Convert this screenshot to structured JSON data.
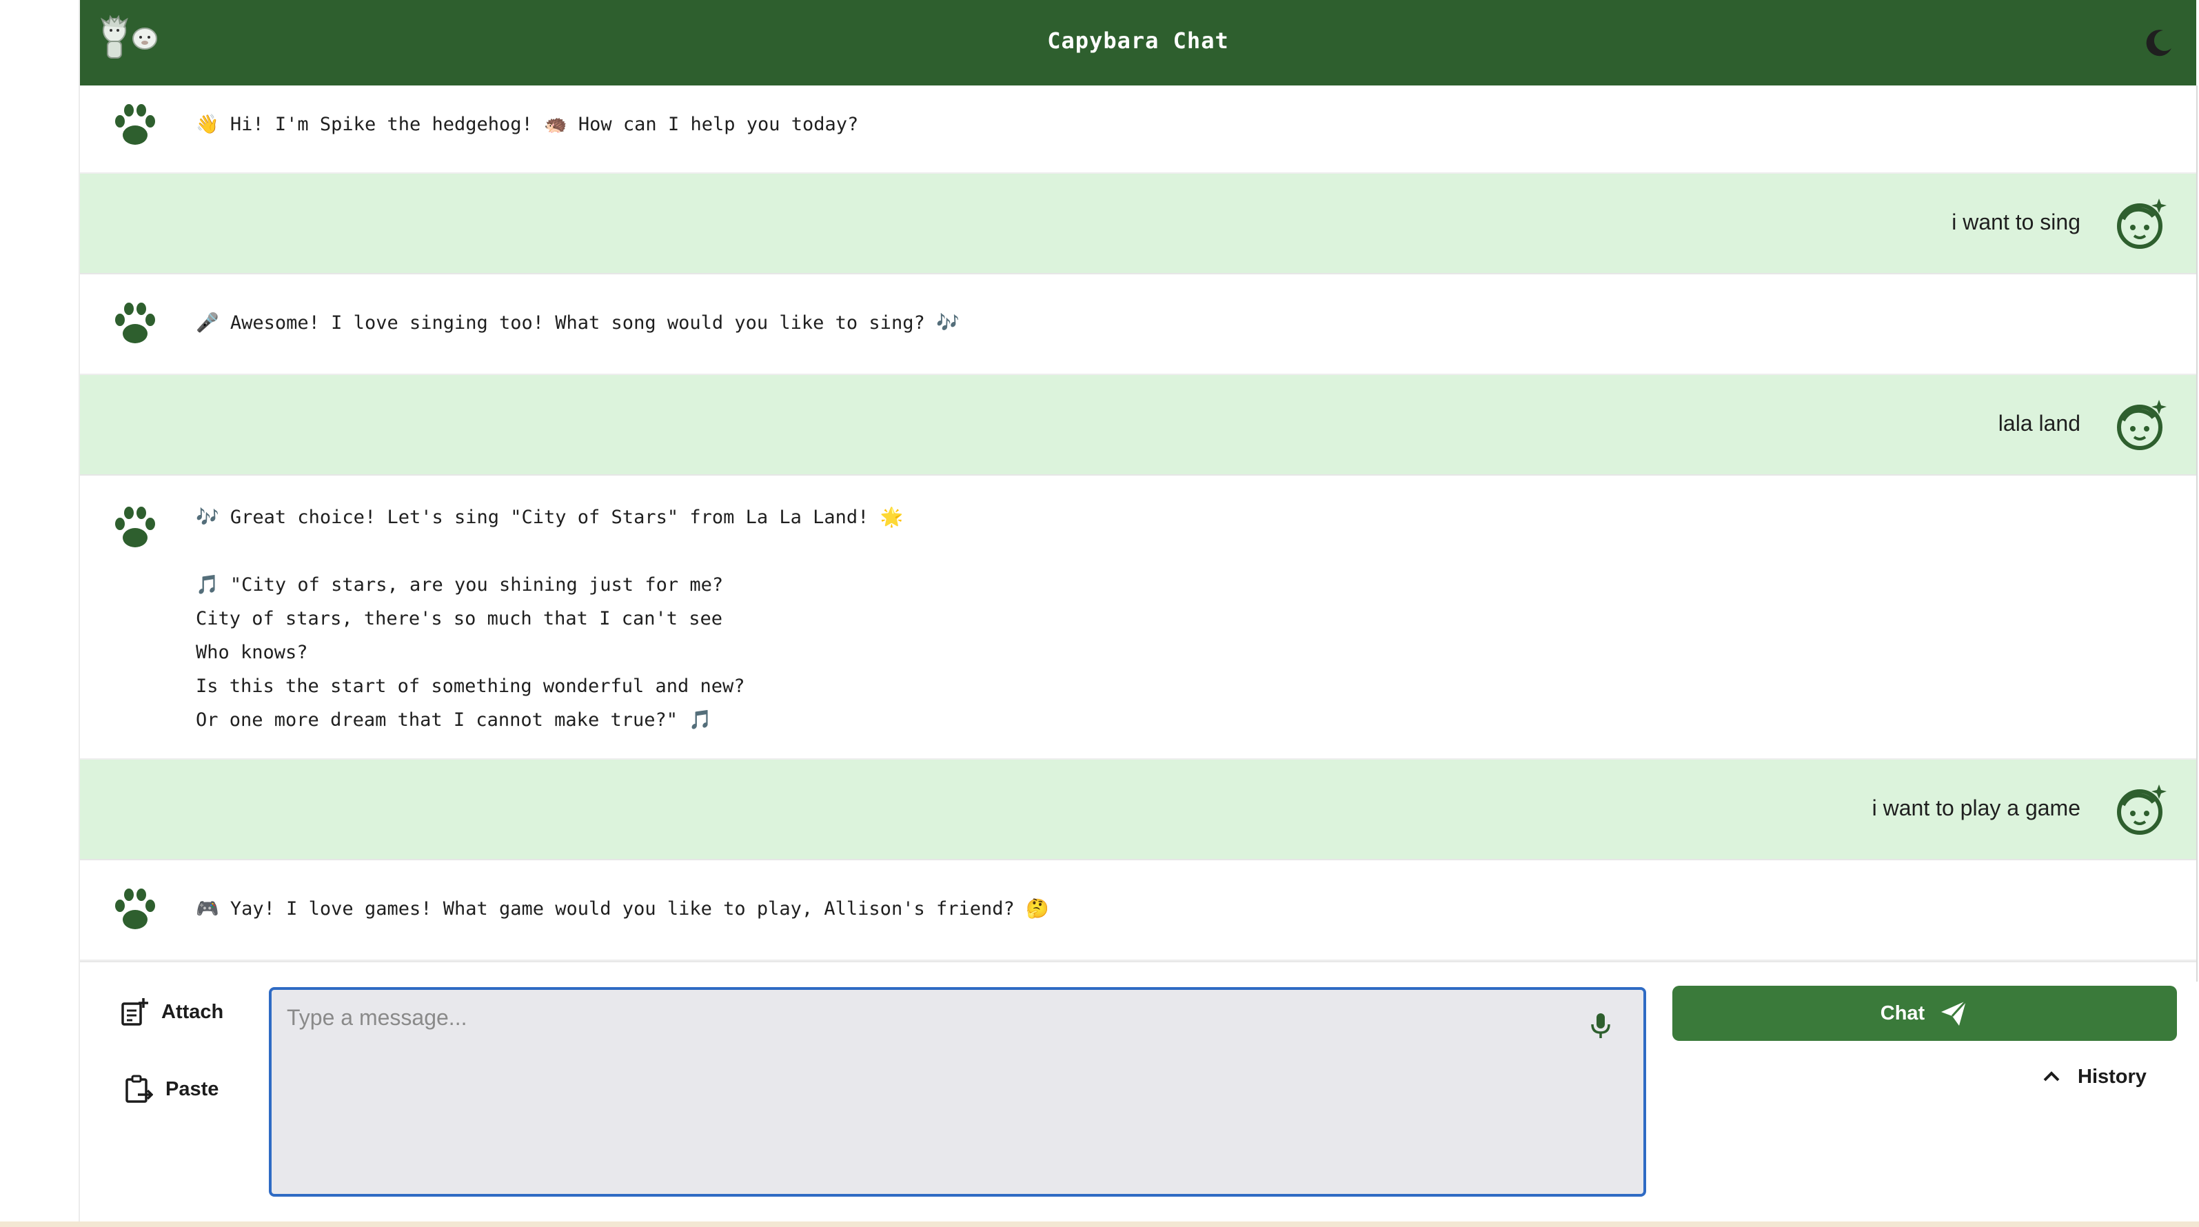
{
  "header": {
    "title": "Capybara Chat",
    "logo_icon": "hedgehog-and-capybara-logo",
    "theme_icon": "moon-icon"
  },
  "messages": [
    {
      "role": "bot",
      "text": "👋 Hi! I'm Spike the hedgehog! 🦔 How can I help you today?"
    },
    {
      "role": "user",
      "text": "i want to sing"
    },
    {
      "role": "bot",
      "text": "🎤 Awesome! I love singing too! What song would you like to sing? 🎶"
    },
    {
      "role": "user",
      "text": "lala land"
    },
    {
      "role": "bot",
      "text": "🎶 Great choice! Let's sing \"City of Stars\" from La La Land! 🌟\n\n🎵 \"City of stars, are you shining just for me?\nCity of stars, there's so much that I can't see\nWho knows?\nIs this the start of something wonderful and new?\nOr one more dream that I cannot make true?\" 🎵"
    },
    {
      "role": "user",
      "text": "i want to play a game"
    },
    {
      "role": "bot",
      "text": "🎮 Yay! I love games! What game would you like to play, Allison's friend? 🤔"
    }
  ],
  "composer": {
    "attach_label": "Attach",
    "paste_label": "Paste",
    "placeholder": "Type a message...",
    "chat_label": "Chat",
    "history_label": "History"
  },
  "colors": {
    "header_bg": "#2e5f2e",
    "user_bubble_bg": "#dcf3dc",
    "accent_green": "#3a7a3a",
    "input_border": "#2f6bc4"
  }
}
